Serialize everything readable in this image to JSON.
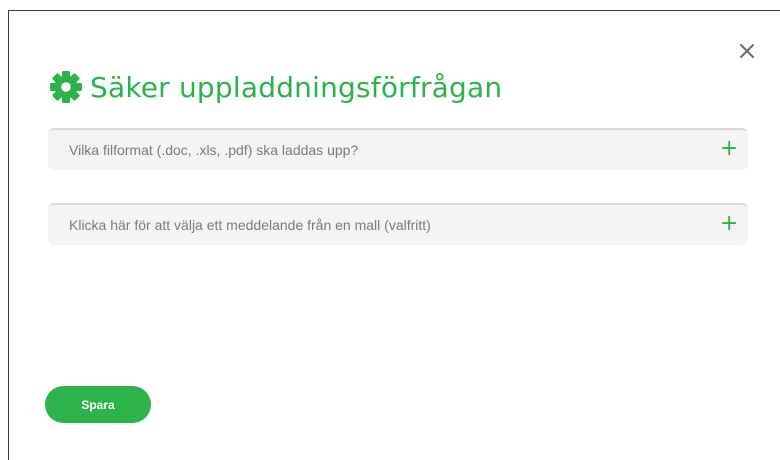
{
  "dialog": {
    "title": "Säker uppladdningsförfrågan",
    "title_icon": "gear-icon",
    "close_icon": "close-icon",
    "fields": [
      {
        "placeholder": "Vilka filformat (.doc, .xls, .pdf) ska laddas upp?",
        "action_icon": "plus-icon",
        "action_glyph": "+"
      },
      {
        "placeholder": "Klicka här för att välja ett meddelande från en mall (valfritt)",
        "action_icon": "plus-icon",
        "action_glyph": "+"
      }
    ],
    "save_label": "Spara"
  },
  "colors": {
    "accent": "#2bb34a",
    "field_bg": "#f4f4f5",
    "placeholder_text": "#7a7a7a",
    "close_icon": "#6b6b6b"
  }
}
